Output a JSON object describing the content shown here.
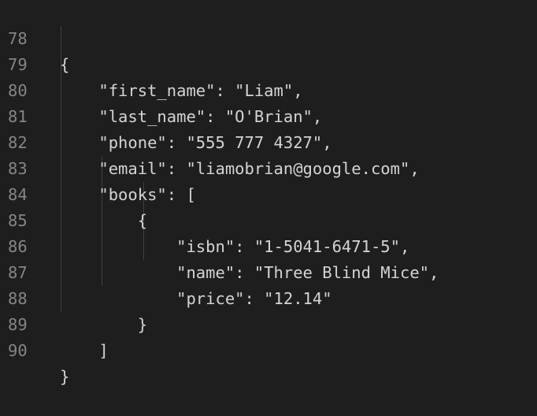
{
  "lines": [
    {
      "num": "78",
      "text": "{"
    },
    {
      "num": "79",
      "text": "    \"first_name\": \"Liam\","
    },
    {
      "num": "80",
      "text": "    \"last_name\": \"O'Brian\","
    },
    {
      "num": "81",
      "text": "    \"phone\": \"555 777 4327\","
    },
    {
      "num": "82",
      "text": "    \"email\": \"liamobrian@google.com\","
    },
    {
      "num": "83",
      "text": "    \"books\": ["
    },
    {
      "num": "84",
      "text": "        {"
    },
    {
      "num": "85",
      "text": "            \"isbn\": \"1-5041-6471-5\","
    },
    {
      "num": "86",
      "text": "            \"name\": \"Three Blind Mice\","
    },
    {
      "num": "87",
      "text": "            \"price\": \"12.14\""
    },
    {
      "num": "88",
      "text": "        }"
    },
    {
      "num": "89",
      "text": "    ]"
    },
    {
      "num": "90",
      "text": "}"
    }
  ],
  "colors": {
    "background": "#1e1e1e",
    "text": "#d4d4d4",
    "line_number": "#858585",
    "indent_guide": "#404040"
  }
}
